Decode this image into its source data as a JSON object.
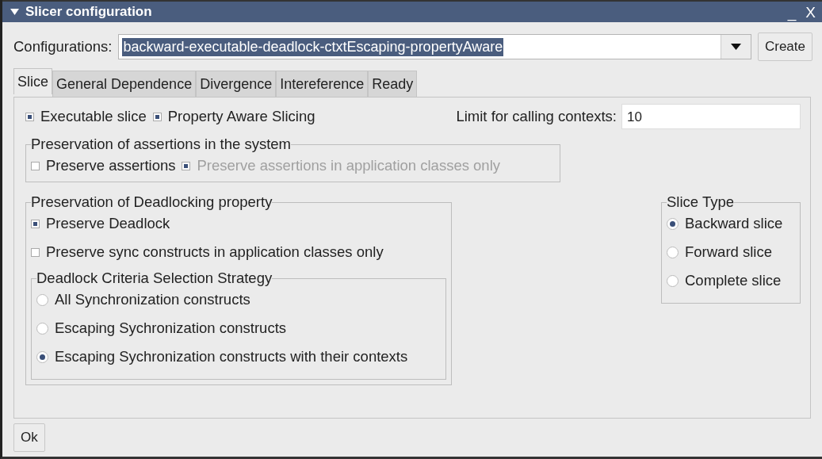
{
  "window": {
    "title": "Slicer configuration",
    "controls": [
      "_",
      "X"
    ]
  },
  "configurations": {
    "label": "Configurations:",
    "value": "backward-executable-deadlock-ctxtEscaping-propertyAware",
    "highlighted": true
  },
  "create_button": "Create",
  "tabs": [
    {
      "label": "Slice",
      "selected": true
    },
    {
      "label": "General Dependence",
      "selected": false
    },
    {
      "label": "Divergence",
      "selected": false
    },
    {
      "label": "Intereference",
      "selected": false
    },
    {
      "label": "Ready",
      "selected": false
    }
  ],
  "options": [
    {
      "label": "Executable slice",
      "checked": true
    },
    {
      "label": "Property Aware Slicing",
      "checked": true
    }
  ],
  "limit": {
    "label": "Limit for calling contexts:",
    "value": "10"
  },
  "assertions_group": {
    "title": "Preservation of assertions in the system",
    "options": [
      {
        "label": "Preserve assertions",
        "checked": false,
        "disabled": false
      },
      {
        "label": "Preserve assertions in application classes only",
        "checked": true,
        "disabled": true
      }
    ]
  },
  "deadlock_group": {
    "title": "Preservation of Deadlocking property",
    "options": [
      {
        "label": "Preserve Deadlock",
        "checked": true
      },
      {
        "label": "Preserve sync constructs in application classes only",
        "checked": false
      }
    ],
    "strategy": {
      "title": "Deadlock Criteria Selection Strategy",
      "options": [
        {
          "label": "All Synchronization constructs",
          "selected": false
        },
        {
          "label": "Escaping Sychronization constructs",
          "selected": false
        },
        {
          "label": "Escaping Sychronization constructs with their contexts",
          "selected": true
        }
      ]
    }
  },
  "slice_type": {
    "title": "Slice Type",
    "options": [
      {
        "label": "Backward slice",
        "selected": true
      },
      {
        "label": "Forward slice",
        "selected": false
      },
      {
        "label": "Complete slice",
        "selected": false
      }
    ]
  },
  "ok_button": "Ok"
}
